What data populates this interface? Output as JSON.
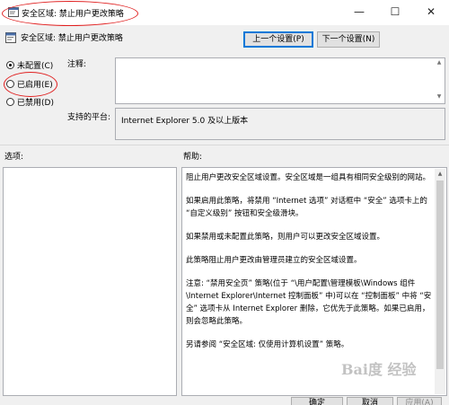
{
  "window": {
    "title": "安全区域: 禁止用户更改策略",
    "minimize": "—",
    "maximize": "☐",
    "close": "✕"
  },
  "header": {
    "title": "安全区域: 禁止用户更改策略",
    "prev_button": "上一个设置(P)",
    "next_button": "下一个设置(N)"
  },
  "state": {
    "options": [
      {
        "label": "未配置(C)",
        "checked": true
      },
      {
        "label": "已启用(E)",
        "checked": false
      },
      {
        "label": "已禁用(D)",
        "checked": false
      }
    ]
  },
  "comment": {
    "label": "注释:",
    "value": ""
  },
  "platform": {
    "label": "支持的平台:",
    "value": "Internet Explorer 5.0 及以上版本"
  },
  "options_panel": {
    "label": "选项:"
  },
  "help_panel": {
    "label": "帮助:",
    "paragraphs": [
      "阻止用户更改安全区域设置。安全区域是一组具有相同安全级别的网站。",
      "如果启用此策略，将禁用 “Internet 选项” 对话框中 “安全” 选项卡上的 “自定义级别” 按钮和安全级滑块。",
      "如果禁用或未配置此策略，则用户可以更改安全区域设置。",
      "此策略阻止用户更改由管理员建立的安全区域设置。",
      "注意: “禁用安全页” 策略(位于 “\\用户配置\\管理模板\\Windows 组件\\Internet Explorer\\Internet 控制面板” 中)可以在 “控制面板” 中将 “安全” 选项卡从 Internet Explorer 删除，它优先于此策略。如果已启用，则会忽略此策略。",
      "另请参阅 “安全区域: 仅使用计算机设置” 策略。"
    ]
  },
  "footer": {
    "ok": "确定",
    "cancel": "取消",
    "apply": "应用(A)"
  },
  "watermark": "Bai度 经验",
  "colors": {
    "annotation": "#e02020",
    "window_bg": "#f0f0f0",
    "accent": "#0078d7"
  }
}
